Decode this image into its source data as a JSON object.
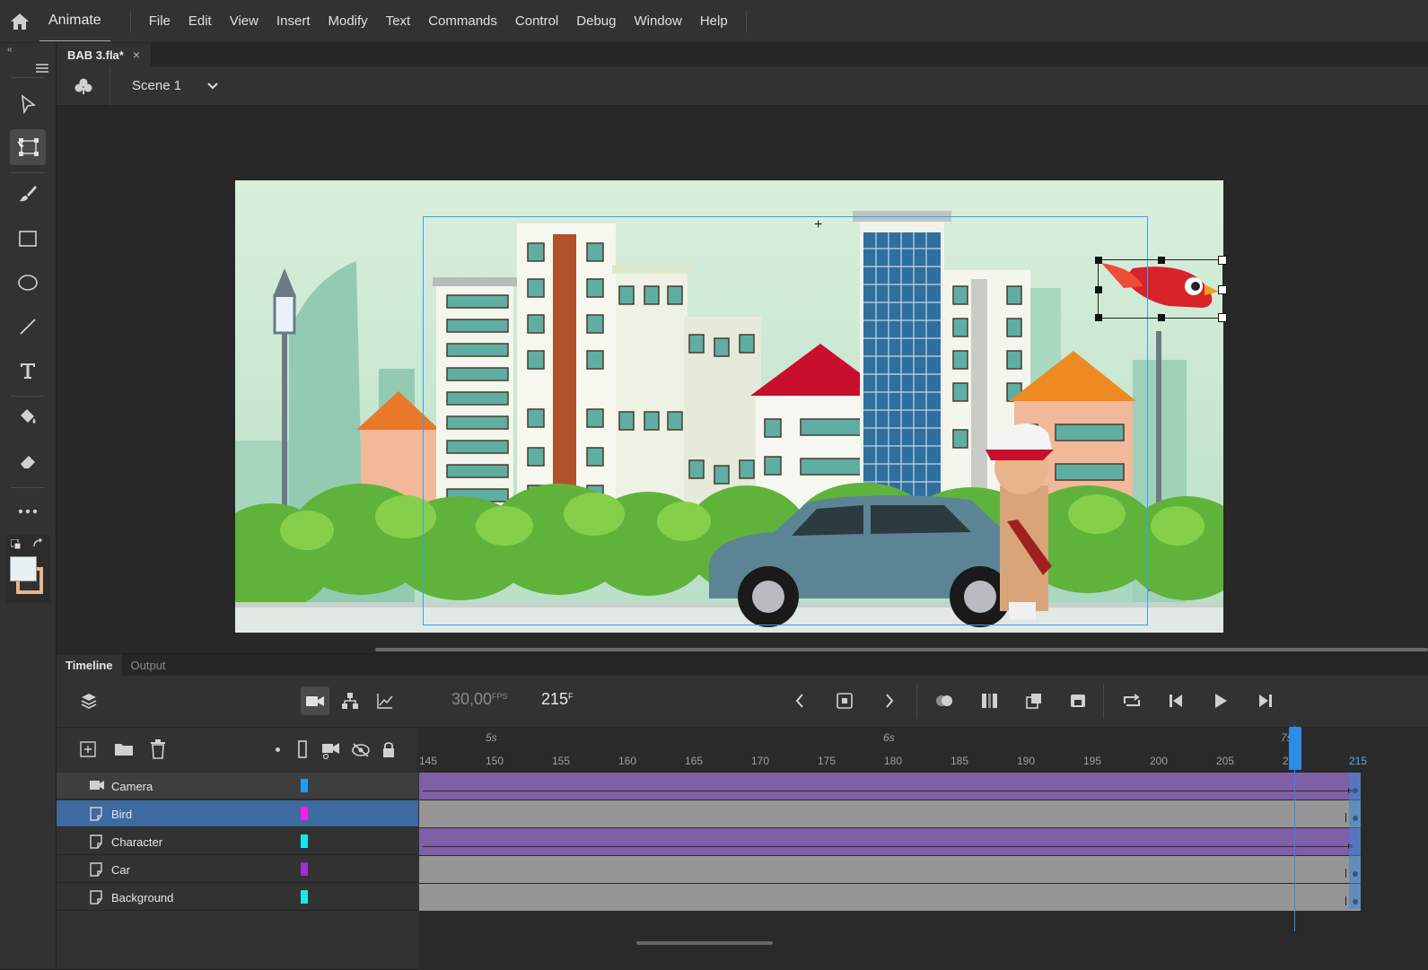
{
  "app": {
    "name": "Animate",
    "menus": [
      "File",
      "Edit",
      "View",
      "Insert",
      "Modify",
      "Text",
      "Commands",
      "Control",
      "Debug",
      "Window",
      "Help"
    ]
  },
  "document": {
    "tab_title": "BAB 3.fla*",
    "close_glyph": "×"
  },
  "scene": {
    "name": "Scene 1"
  },
  "tools": [
    "selection-tool",
    "free-transform-tool",
    "brush-tool",
    "rectangle-tool",
    "oval-tool",
    "line-tool",
    "text-tool",
    "paint-bucket-tool",
    "eraser-tool",
    "more-tools"
  ],
  "timeline": {
    "tabs": [
      "Timeline",
      "Output"
    ],
    "fps_value": "30,00",
    "fps_unit": "FPS",
    "current_frame": "215",
    "frame_unit": "F",
    "second_labels": [
      "5s",
      "6s",
      "7s"
    ],
    "frame_labels": [
      "145",
      "150",
      "155",
      "160",
      "165",
      "170",
      "175",
      "180",
      "185",
      "190",
      "195",
      "200",
      "205",
      "21",
      "215"
    ],
    "layers": [
      {
        "name": "Camera",
        "color": "#1e9bff",
        "type": "camera",
        "frames": "tween"
      },
      {
        "name": "Bird",
        "color": "#ff1ee8",
        "type": "layer",
        "frames": "static",
        "selected": true
      },
      {
        "name": "Character",
        "color": "#19e8e8",
        "type": "layer",
        "frames": "tween"
      },
      {
        "name": "Car",
        "color": "#9b30d0",
        "type": "layer",
        "frames": "static"
      },
      {
        "name": "Background",
        "color": "#19e8e8",
        "type": "layer",
        "frames": "static"
      }
    ]
  },
  "colors": {
    "accent": "#2b8be6",
    "tween": "#7f5fa5",
    "static_frames": "#969696",
    "selected_layer": "#3d6aa0"
  }
}
